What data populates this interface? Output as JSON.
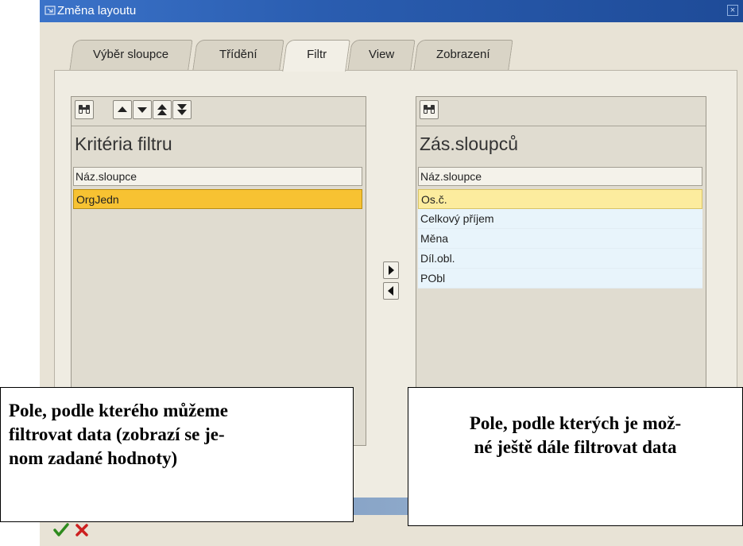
{
  "window": {
    "title": "Změna layoutu"
  },
  "tabs": [
    {
      "label": "Výběr sloupce"
    },
    {
      "label": "Třídění"
    },
    {
      "label": "Filtr"
    },
    {
      "label": "View"
    },
    {
      "label": "Zobrazení"
    }
  ],
  "left_panel": {
    "title": "Kritéria filtru",
    "column_header": "Náz.sloupce",
    "rows": [
      "OrgJedn"
    ]
  },
  "right_panel": {
    "title": "Zás.sloupců",
    "column_header": "Náz.sloupce",
    "rows": [
      "Os.č.",
      "Celkový příjem",
      "Měna",
      "Díl.obl.",
      "PObl"
    ]
  },
  "annotations": {
    "left": "Pole, podle kterého můžeme filtrovat data (zobrazí se jenom zadané hodnoty)",
    "left_lines": [
      "Pole, podle kterého můžeme",
      "filtrovat data (zobrazí se je-",
      "nom zadané hodnoty)"
    ],
    "right_lines": [
      "Pole, podle kterých je mož-",
      "né ještě dále filtrovat data"
    ]
  },
  "icons": {
    "find": "binoculars-icon",
    "confirm": "checkmark-icon",
    "cancel": "cross-icon"
  },
  "colors": {
    "titlebar": "#2a5db0",
    "selected_row": "#f7c232",
    "highlight_row": "#fcec9e",
    "list_row": "#e8f4fb",
    "confirm": "#2e8b1e",
    "cancel": "#cc2020"
  }
}
